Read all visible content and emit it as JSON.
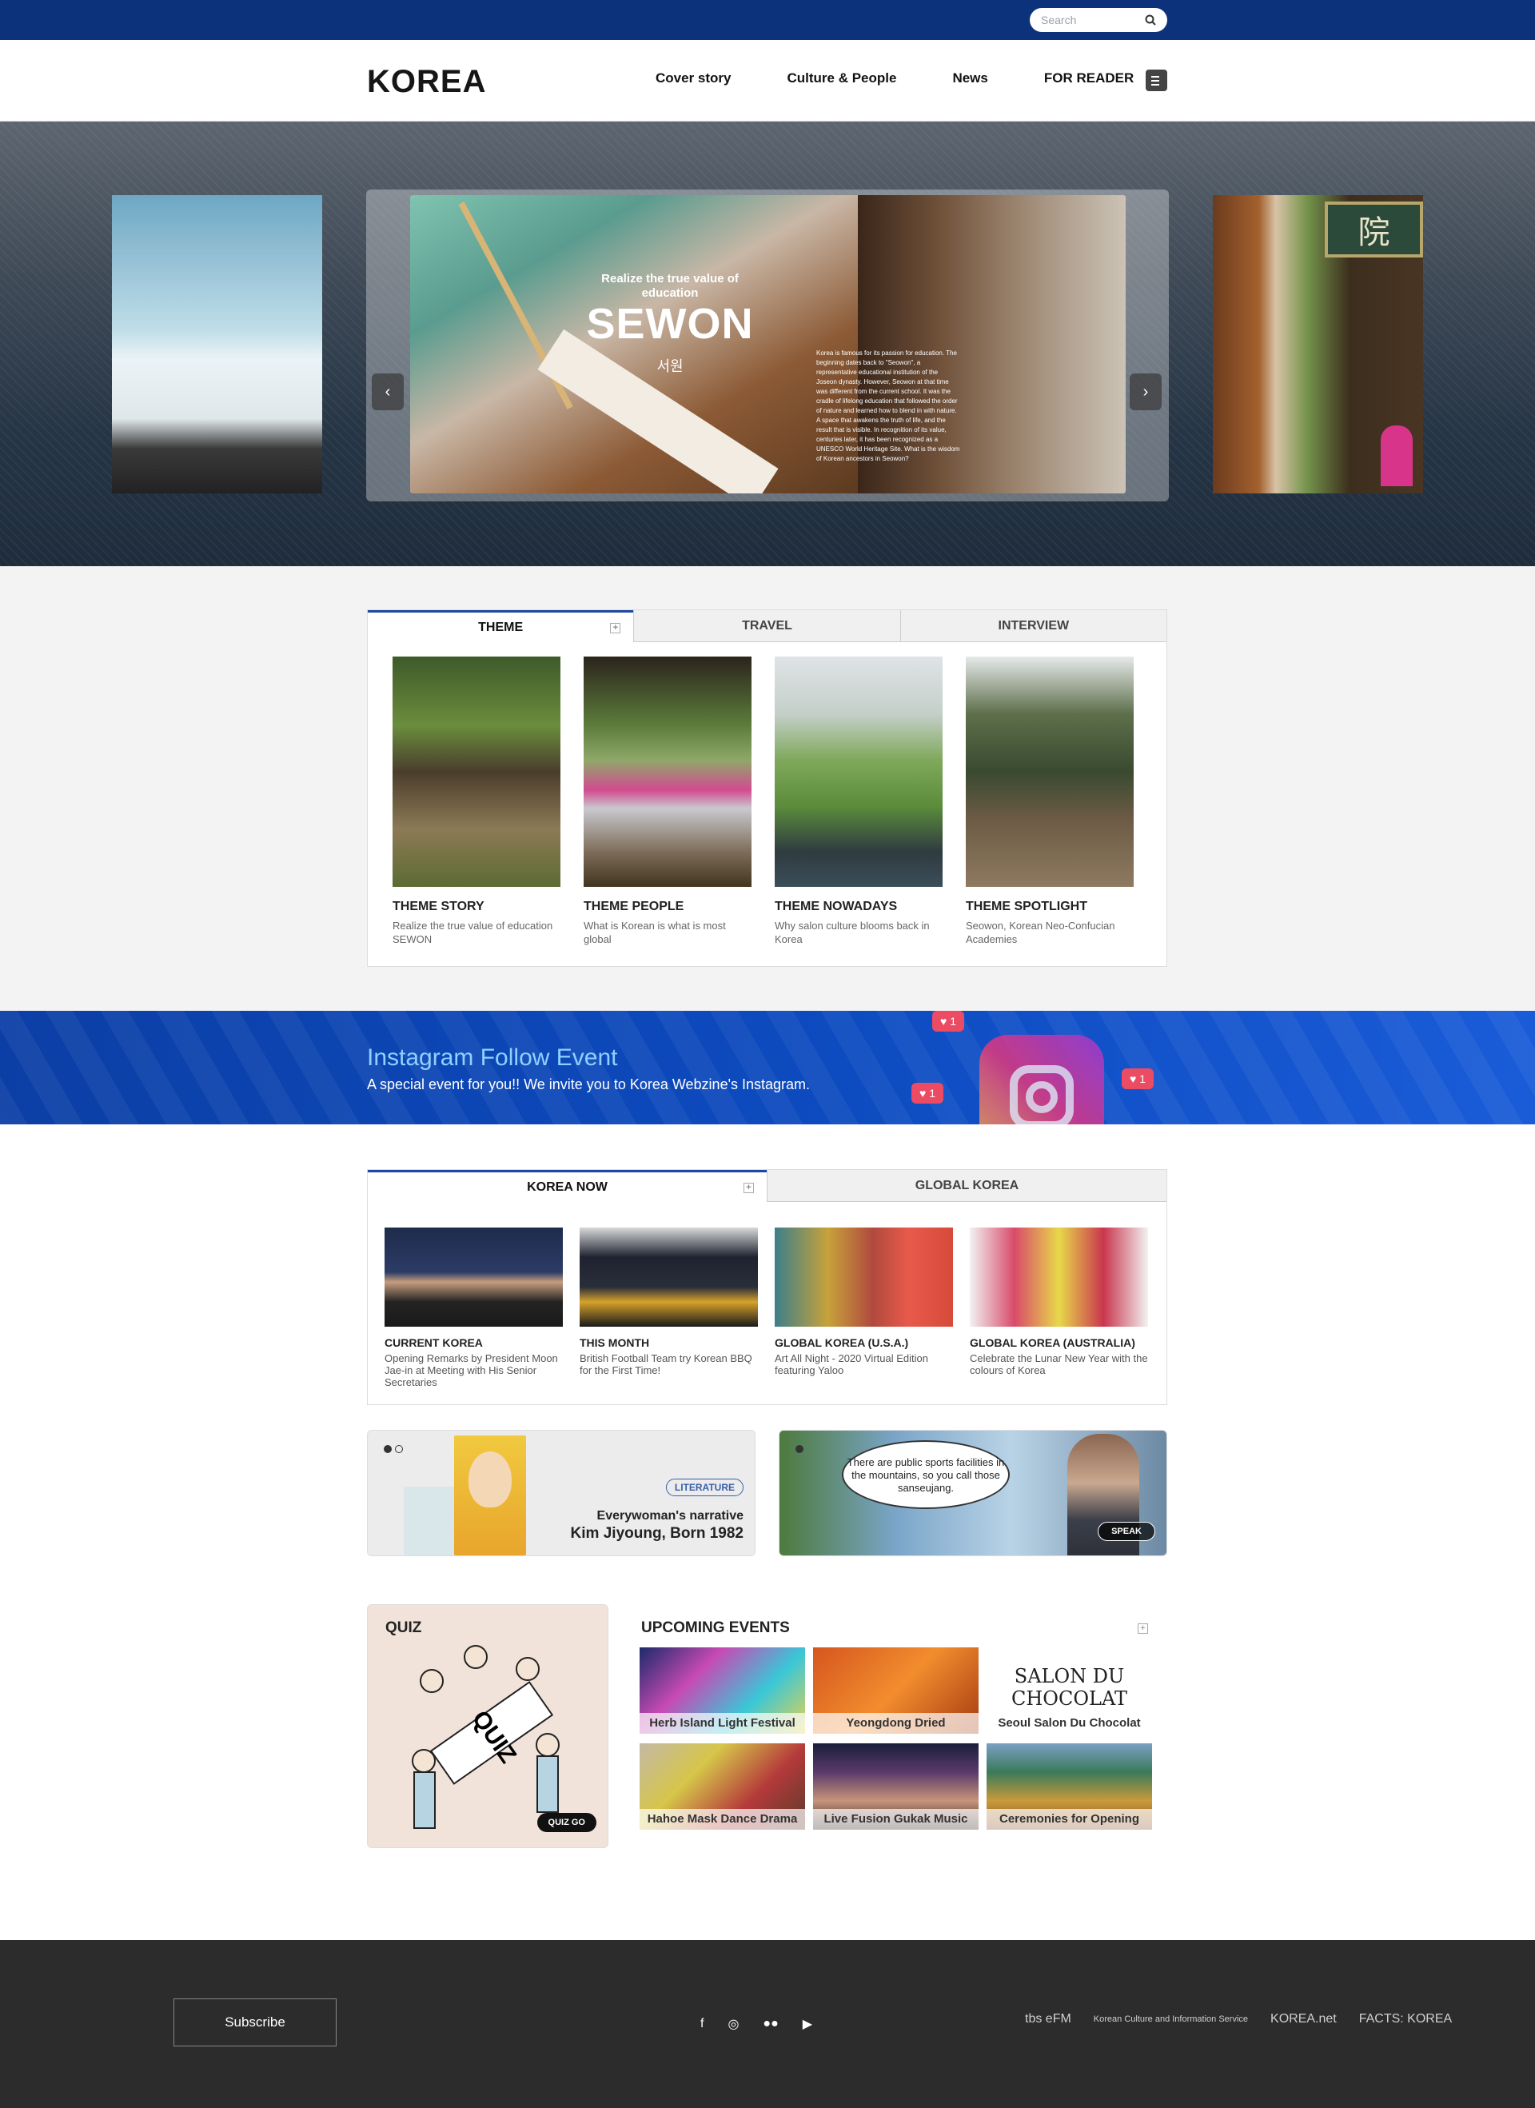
{
  "search": {
    "placeholder": "Search"
  },
  "header": {
    "logo": "KOREA",
    "nav": [
      "Cover story",
      "Culture & People",
      "News",
      "FOR READER"
    ]
  },
  "hero": {
    "subtitle": "Realize the true value of education",
    "title": "SEWON",
    "title_kr": "서원",
    "body": "Korea is famous for its passion for education. The beginning dates back to \"Seowon\", a representative educational institution of the Joseon dynasty. However, Seowon at that time was different from the current school. It was the cradle of lifelong education that followed the order of nature and learned how to blend in with nature. A space that awakens the truth of life, and the result that is visible. In recognition of its value, centuries later, it has been recognized as a UNESCO World Heritage Site. What is the wisdom of Korean ancestors in Seowon?",
    "prev": "‹",
    "next": "›"
  },
  "theme_tabs": {
    "tabs": [
      "THEME",
      "TRAVEL",
      "INTERVIEW"
    ],
    "cards": [
      {
        "title": "THEME STORY",
        "desc": "Realize the true value of education SEWON"
      },
      {
        "title": "THEME PEOPLE",
        "desc": "What is Korean is what is most global"
      },
      {
        "title": "THEME NOWADAYS",
        "desc": "Why salon culture blooms back in Korea"
      },
      {
        "title": "THEME SPOTLIGHT",
        "desc": "Seowon, Korean Neo-Confucian Academies"
      }
    ]
  },
  "instagram": {
    "title": "Instagram Follow Event",
    "desc": "A special event for you!! We invite you to Korea Webzine's Instagram.",
    "likes": "♥ 1"
  },
  "now_tabs": {
    "tabs": [
      "KOREA NOW",
      "GLOBAL KOREA"
    ],
    "cards": [
      {
        "title": "CURRENT KOREA",
        "desc": "Opening Remarks by President Moon Jae-in at Meeting with His Senior Secretaries"
      },
      {
        "title": "THIS MONTH",
        "desc": "British Football Team try Korean BBQ for the First Time!"
      },
      {
        "title": "GLOBAL KOREA (U.S.A.)",
        "desc": "Art All Night - 2020 Virtual Edition featuring Yaloo"
      },
      {
        "title": "GLOBAL KOREA (AUSTRALIA)",
        "desc": "Celebrate the Lunar New Year with the colours of Korea"
      }
    ]
  },
  "banners": {
    "literature": {
      "tag": "LITERATURE",
      "line1": "Everywoman's narrative",
      "line2": "Kim Jiyoung, Born 1982"
    },
    "speak": {
      "bubble": "There are public sports facilities in the mountains, so you call those sanseujang.",
      "button": "SPEAK"
    }
  },
  "quiz": {
    "title": "QUIZ",
    "button": "QUIZ GO"
  },
  "events": {
    "title": "UPCOMING EVENTS",
    "items": [
      "Herb Island Light Festival",
      "Yeongdong Dried Persimmon",
      "Seoul Salon Du Chocolat",
      "Hahoe Mask Dance Drama",
      "Live Fusion Gukak Music",
      "Ceremonies for Opening"
    ]
  },
  "footer": {
    "subscribe": "Subscribe",
    "social": [
      "f",
      "◎",
      "●●",
      "▶"
    ],
    "partners": [
      "tbs eFM",
      "Korean Culture and Information Service",
      "KOREA.net",
      "FACTS: KOREA"
    ]
  }
}
